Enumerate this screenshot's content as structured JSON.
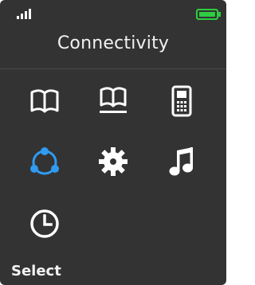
{
  "status": {
    "signal_icon": "signal-strength-icon",
    "battery_icon": "battery-full-icon",
    "battery_color": "#2ecc40"
  },
  "header": {
    "title": "Connectivity"
  },
  "menu": {
    "items": [
      {
        "icon": "book-open-icon",
        "selected": false
      },
      {
        "icon": "book-underlined-icon",
        "selected": false
      },
      {
        "icon": "mobile-phone-icon",
        "selected": false
      },
      {
        "icon": "connectivity-network-icon",
        "selected": true
      },
      {
        "icon": "settings-gear-icon",
        "selected": false
      },
      {
        "icon": "music-note-icon",
        "selected": false
      },
      {
        "icon": "clock-icon",
        "selected": false
      }
    ],
    "highlight_color": "#2f9bf2",
    "icon_color": "#ffffff"
  },
  "softkeys": {
    "left_label": "Select"
  }
}
